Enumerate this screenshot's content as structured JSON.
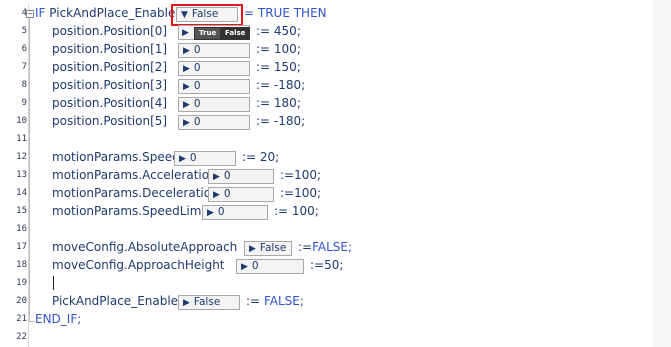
{
  "gutter": {
    "line_numbers": [
      "4",
      "5",
      "6",
      "7",
      "8",
      "9",
      "10",
      "11",
      "12",
      "13",
      "14",
      "15",
      "16",
      "17",
      "18",
      "19",
      "20",
      "21",
      "22"
    ]
  },
  "code": {
    "line4": {
      "if_kw": "IF",
      "var": "PickAndPlace_Enabled",
      "dropdown_value": "False",
      "after": "= TRUE THEN",
      "triangle": "▼"
    },
    "line5": {
      "text": "position.Position[0]",
      "assign": ":= 450;",
      "toggle_true": "True",
      "toggle_false": "False"
    },
    "line6": {
      "text": "position.Position[1]",
      "value": "0",
      "assign": ":= 100;"
    },
    "line7": {
      "text": "position.Position[2]",
      "value": "0",
      "assign": ":= 150;"
    },
    "line8": {
      "text": "position.Position[3]",
      "value": "0",
      "assign": ":= -180;"
    },
    "line9": {
      "text": "position.Position[4]",
      "value": "0",
      "assign": ":= 180;"
    },
    "line10": {
      "text": "position.Position[5]",
      "value": "0",
      "assign": ":= -180;"
    },
    "line12": {
      "text": "motionParams.Speed",
      "value": "0",
      "assign": ":= 20;"
    },
    "line13": {
      "text": "motionParams.Acceleration",
      "value": "0",
      "assign": ":=100;"
    },
    "line14": {
      "text": "motionParams.Deceleration",
      "value": "0",
      "assign": ":=100;"
    },
    "line15": {
      "text": "motionParams.SpeedLimit",
      "value": "0",
      "assign": ":= 100;"
    },
    "line17": {
      "text": "moveConfig.AbsoluteApproach",
      "value": "False",
      "assign_op": ":=",
      "assign_val": "FALSE;"
    },
    "line18": {
      "text": "moveConfig.ApproachHeight",
      "value": "0",
      "assign": ":=50;"
    },
    "line20": {
      "text": "PickAndPlace_Enabled",
      "value": "False",
      "assign_op": ":=",
      "assign_val": "FALSE;"
    },
    "line21": {
      "end_kw": "END_IF;"
    },
    "play_triangle": "▶"
  },
  "colors": {
    "keyword": "#2f55c8",
    "text": "#1f3a6e",
    "highlight": "#e8141c"
  }
}
